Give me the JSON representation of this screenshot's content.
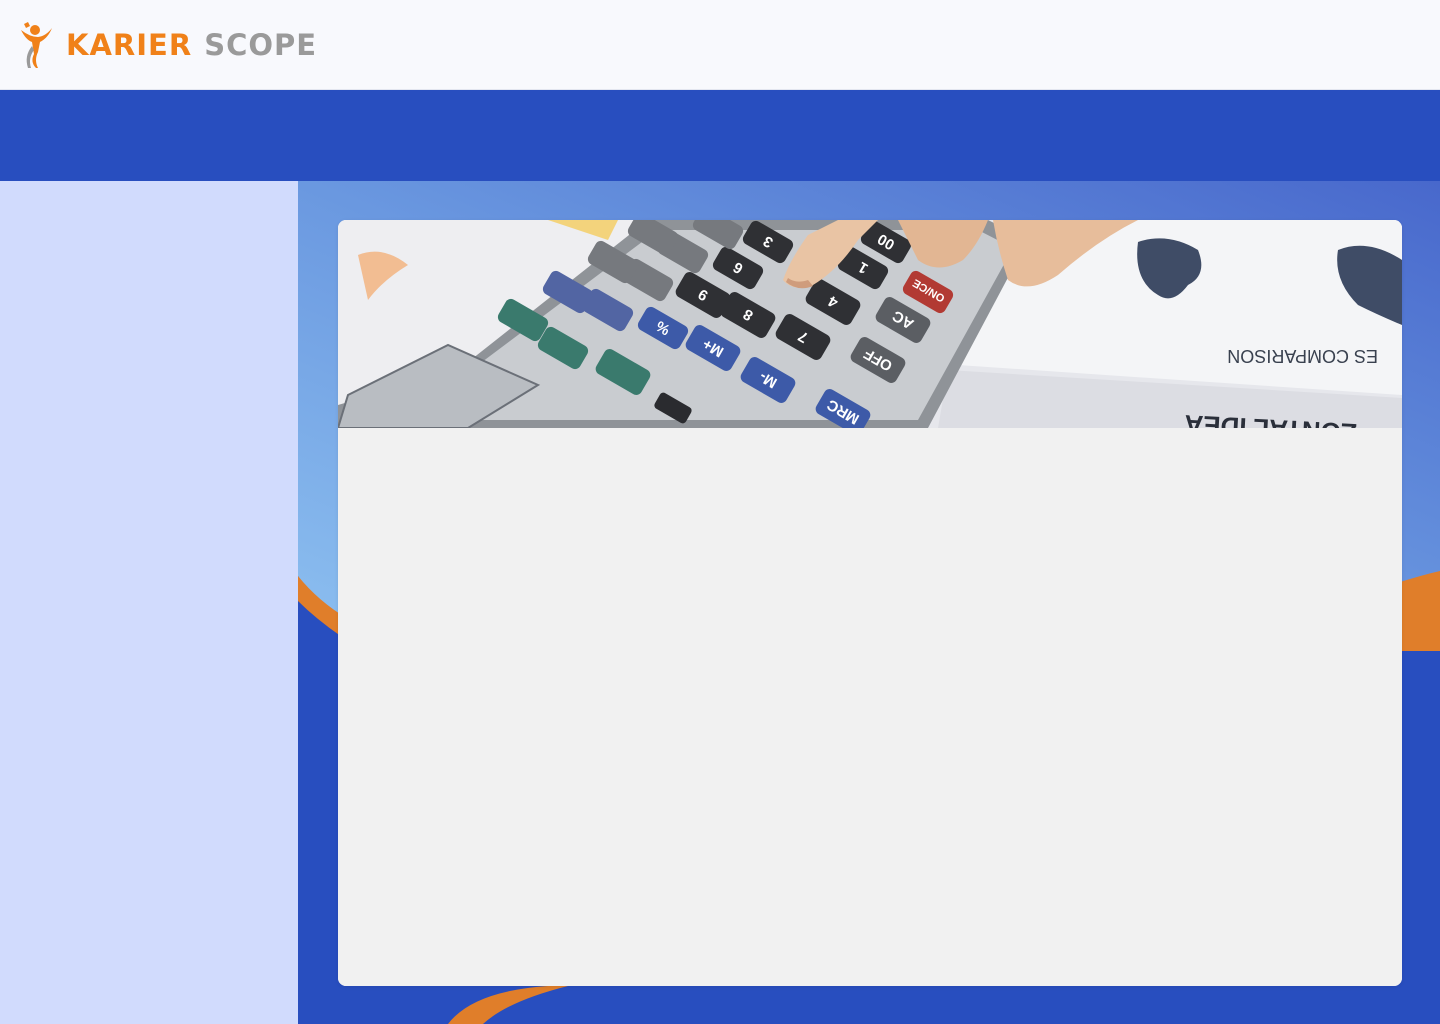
{
  "header": {
    "brand_primary": "KARIER",
    "brand_secondary": "SCOPE",
    "logo_icon": "person-target-logo-icon"
  },
  "colors": {
    "brand_orange": "#f08119",
    "brand_gray": "#9a9a9a",
    "nav_blue": "#284ebf",
    "sidebar_bg": "#d1dbfd",
    "card_bg": "#f1f1f1"
  },
  "banner": {
    "image_subject": "calculator-photo",
    "calculator_keys": [
      "MRC",
      "M-",
      "M+",
      "%",
      "OFF",
      "AC",
      "ON/CE",
      "7",
      "8",
      "9",
      "4",
      "1",
      "00",
      "6",
      "3"
    ],
    "document_text": [
      "ES COMPARISON",
      "ZONTAL IDEA"
    ]
  }
}
